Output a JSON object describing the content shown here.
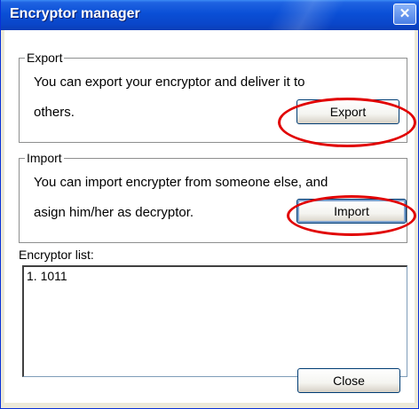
{
  "window": {
    "title": "Encryptor manager"
  },
  "export": {
    "legend": "Export",
    "desc_line1": "You can export your encryptor and deliver it to",
    "desc_line2": "others.",
    "button": "Export"
  },
  "import": {
    "legend": "Import",
    "desc_line1": "You can import encrypter from someone else, and",
    "desc_line2": "asign him/her as decryptor.",
    "button": "Import"
  },
  "list": {
    "label": "Encryptor list:",
    "items": [
      "1. 1011"
    ]
  },
  "footer": {
    "close_button": "Close"
  },
  "colors": {
    "title_bar": "#0a4fd6",
    "annotation_ring": "#e10000",
    "frame": "#8e8f8f"
  }
}
